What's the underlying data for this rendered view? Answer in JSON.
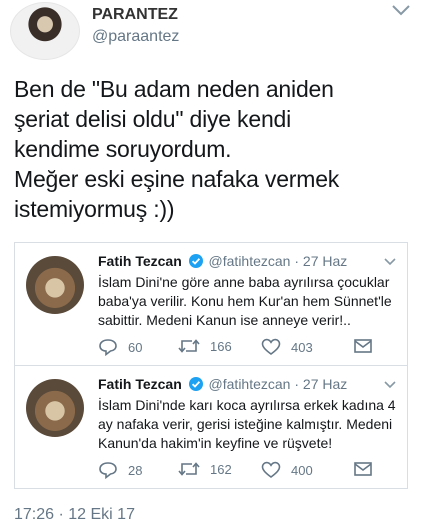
{
  "author": {
    "name": "PARANTEZ",
    "handle": "@paraantez"
  },
  "tweet": {
    "lines": [
      "Ben de \"Bu adam neden aniden",
      "şeriat delisi oldu\" diye kendi",
      "kendime soruyordum.",
      "Meğer eski eşine nafaka vermek",
      "istemiyormuş :))"
    ],
    "timestamp": "17:26 · 12 Eki 17"
  },
  "quotes": [
    {
      "name": "Fatih Tezcan",
      "handle": "@fatihtezcan",
      "date": "· 27 Haz",
      "lines": [
        "İslam Dini'ne göre anne baba ayrılırsa çocuklar",
        "baba'ya verilir. Konu hem Kur'an hem Sünnet'le",
        "sabittir. Medeni Kanun ise anneye verir!.."
      ],
      "replies": "60",
      "retweets": "166",
      "likes": "403"
    },
    {
      "name": "Fatih Tezcan",
      "handle": "@fatihtezcan",
      "date": "· 27 Haz",
      "lines": [
        "İslam Dini'nde karı koca ayrılırsa erkek kadına 4",
        "ay nafaka verir, gerisi isteğine kalmıştır. Medeni",
        "Kanun'da hakim'in keyfine ve rüşvete!"
      ],
      "replies": "28",
      "retweets": "162",
      "likes": "400"
    }
  ],
  "icons": {
    "reply": "reply-icon",
    "retweet": "retweet-icon",
    "like": "heart-icon",
    "dm": "message-icon",
    "verified": "verified-badge-icon",
    "menu": "chevron-down-icon"
  },
  "colors": {
    "text": "#14171a",
    "secondary": "#657786",
    "verified": "#1da1f2",
    "border": "#d8dee3"
  }
}
